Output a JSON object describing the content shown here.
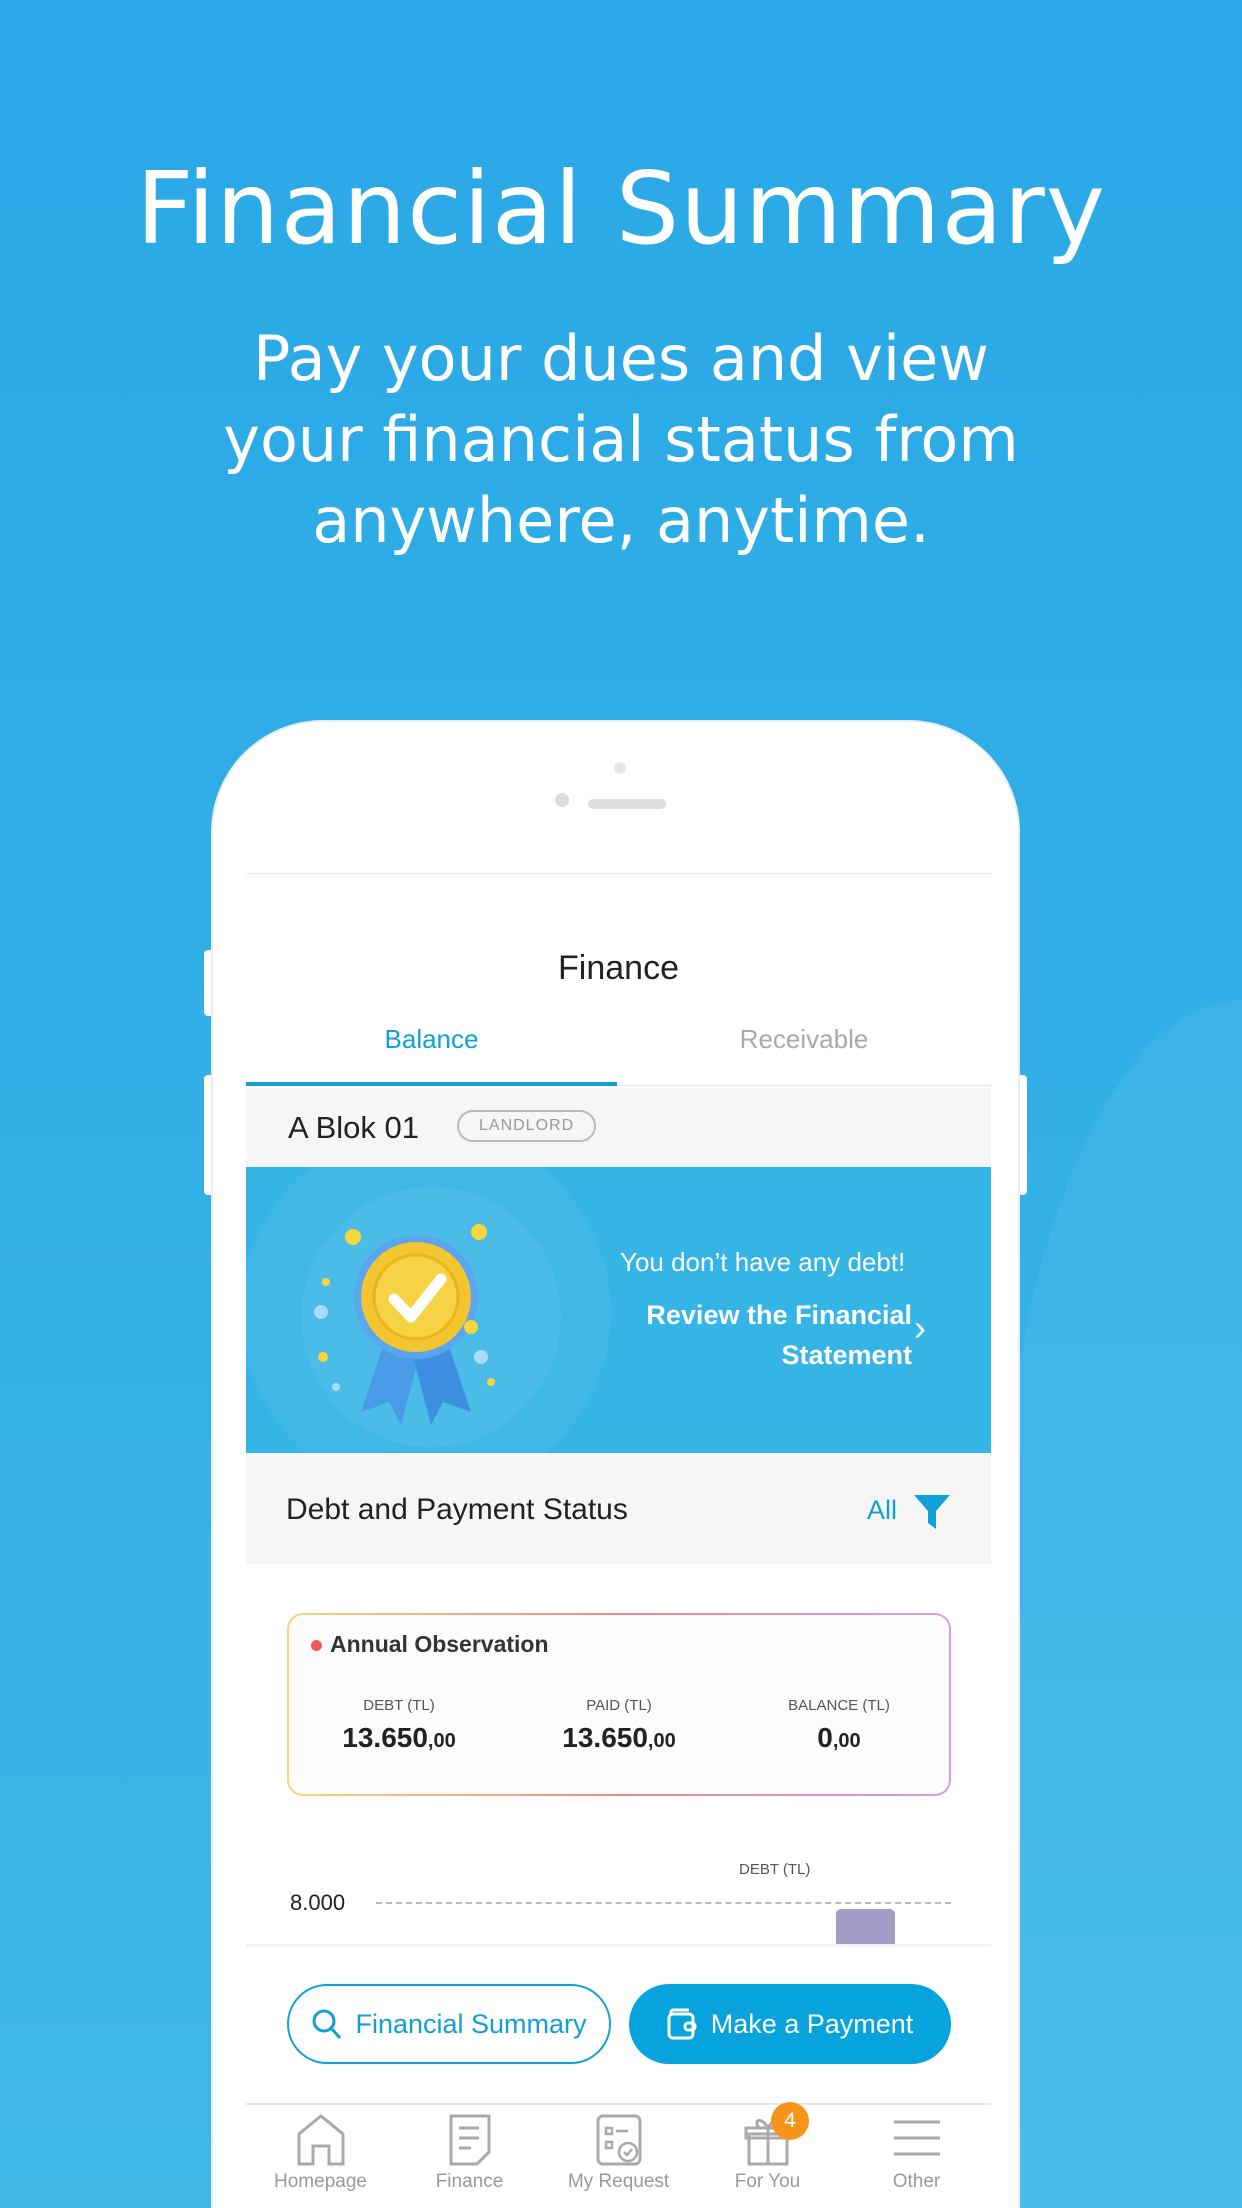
{
  "hero": {
    "title": "Financial Summary",
    "subtitle": "Pay your dues and view\nyour financial status from\nanywhere, anytime."
  },
  "screen": {
    "title": "Finance",
    "tabs": [
      {
        "label": "Balance",
        "active": true
      },
      {
        "label": "Receivable",
        "active": false
      }
    ],
    "unit": {
      "name": "A Blok 01",
      "role_badge": "LANDLORD"
    },
    "banner": {
      "message": "You don’t have any debt!",
      "link": "Review the Financial\nStatement",
      "icon": "medal-check-icon"
    },
    "section": {
      "title": "Debt and Payment Status",
      "filter_label": "All",
      "filter_icon": "filter-icon"
    },
    "annual": {
      "title": "Annual Observation",
      "dot_color": "#ef5b5b",
      "stats": [
        {
          "label": "DEBT (TL)",
          "int": "13.650",
          "dec": ",00"
        },
        {
          "label": "PAID (TL)",
          "int": "13.650",
          "dec": ",00"
        },
        {
          "label": "BALANCE (TL)",
          "int": "0",
          "dec": ",00"
        }
      ]
    },
    "chart_data": {
      "type": "bar",
      "legend": "DEBT (TL)",
      "ytick": "8.000",
      "bar_color": "#a49cc6"
    },
    "buttons": {
      "summary": "Financial Summary",
      "payment": "Make a Payment"
    },
    "nav": [
      {
        "label": "Homepage",
        "icon": "home-icon"
      },
      {
        "label": "Finance",
        "icon": "document-icon"
      },
      {
        "label": "My Request",
        "icon": "checklist-icon"
      },
      {
        "label": "For You",
        "icon": "gift-icon",
        "badge": "4"
      },
      {
        "label": "Other",
        "icon": "menu-icon"
      }
    ]
  },
  "colors": {
    "accent": "#06a3dc",
    "banner": "#35b5e5",
    "badge": "#f7941d"
  }
}
